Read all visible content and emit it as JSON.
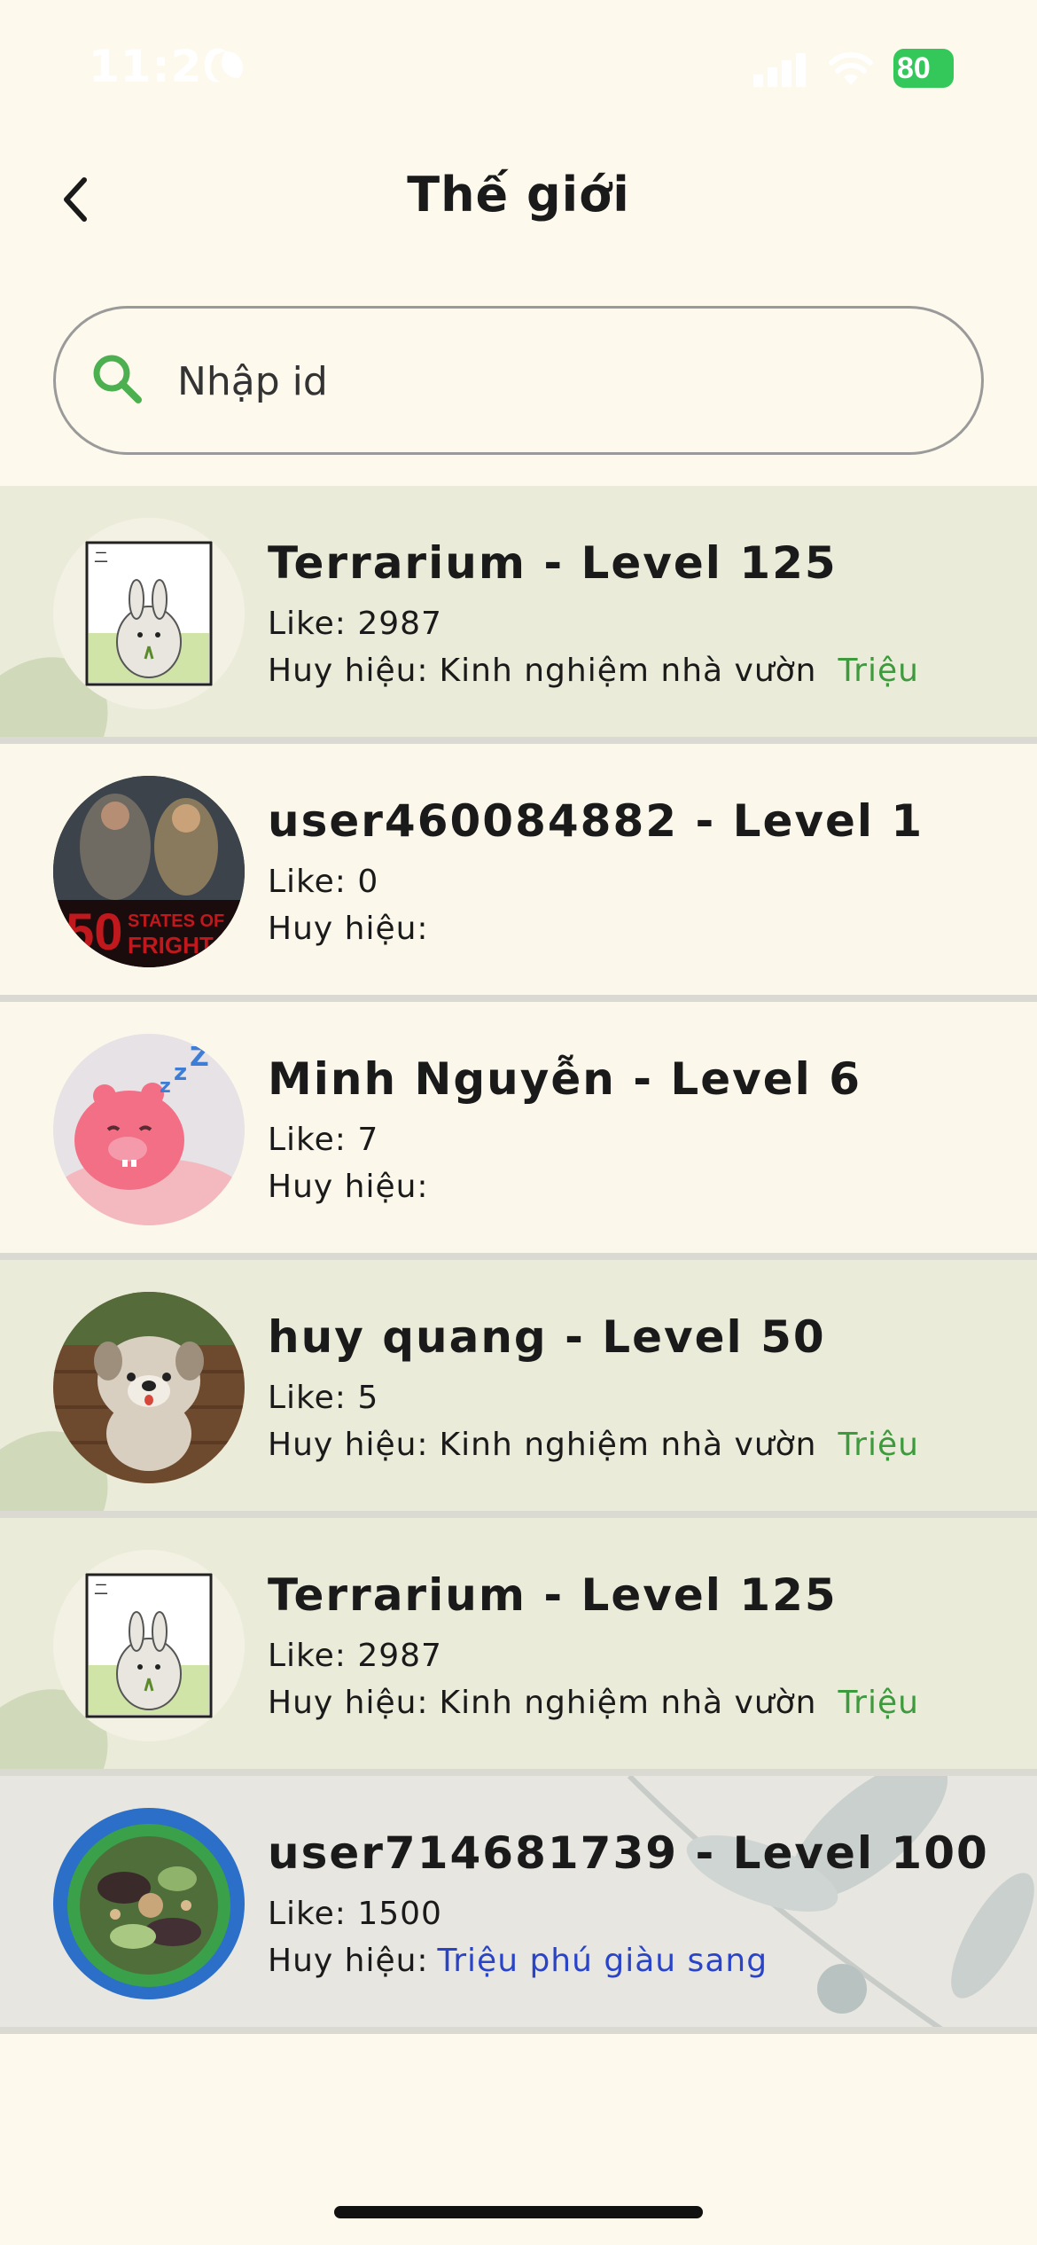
{
  "status_bar": {
    "time": "11:20",
    "battery": "80"
  },
  "header": {
    "title": "Thế giới"
  },
  "search": {
    "placeholder": "Nhập id",
    "value": ""
  },
  "users": [
    {
      "name": "Terrarium - Level 125",
      "like": "Like: 2987",
      "badge_label": "Huy hiệu:",
      "badge_value": "Kinh nghiệm nhà vườn",
      "badge_tag": "Triệu",
      "avatar": "bunny-avatar"
    },
    {
      "name": "user460084882 - Level 1",
      "like": "Like: 0",
      "badge_label": "Huy hiệu:",
      "badge_value": "",
      "badge_tag": "",
      "avatar": "movie-poster-avatar"
    },
    {
      "name": "Minh Nguyễn - Level 6",
      "like": "Like: 7",
      "badge_label": "Huy hiệu:",
      "badge_value": "",
      "badge_tag": "",
      "avatar": "sleeping-pig-avatar"
    },
    {
      "name": "huy quang - Level 50",
      "like": "Like: 5",
      "badge_label": "Huy hiệu:",
      "badge_value": "Kinh nghiệm nhà vườn",
      "badge_tag": "Triệu",
      "avatar": "dog-avatar"
    },
    {
      "name": "Terrarium - Level 125",
      "like": "Like: 2987",
      "badge_label": "Huy hiệu:",
      "badge_value": "Kinh nghiệm nhà vườn",
      "badge_tag": "Triệu",
      "avatar": "bunny-avatar"
    },
    {
      "name": "user714681739 - Level 100",
      "like": "Like: 1500",
      "badge_label": "Huy hiệu:",
      "badge_value": "",
      "badge_tag": "Triệu phú giàu sang",
      "avatar": "food-avatar"
    }
  ],
  "colors": {
    "background": "#fdf9ec",
    "highlight_row": "#ebebd9",
    "badge_green": "#3d9a3d",
    "badge_blue": "#2a44c8",
    "search_icon": "#4caf50"
  },
  "icons": [
    "back-chevron-icon",
    "search-icon",
    "moon-icon",
    "signal-icon",
    "wifi-icon",
    "battery-icon"
  ]
}
